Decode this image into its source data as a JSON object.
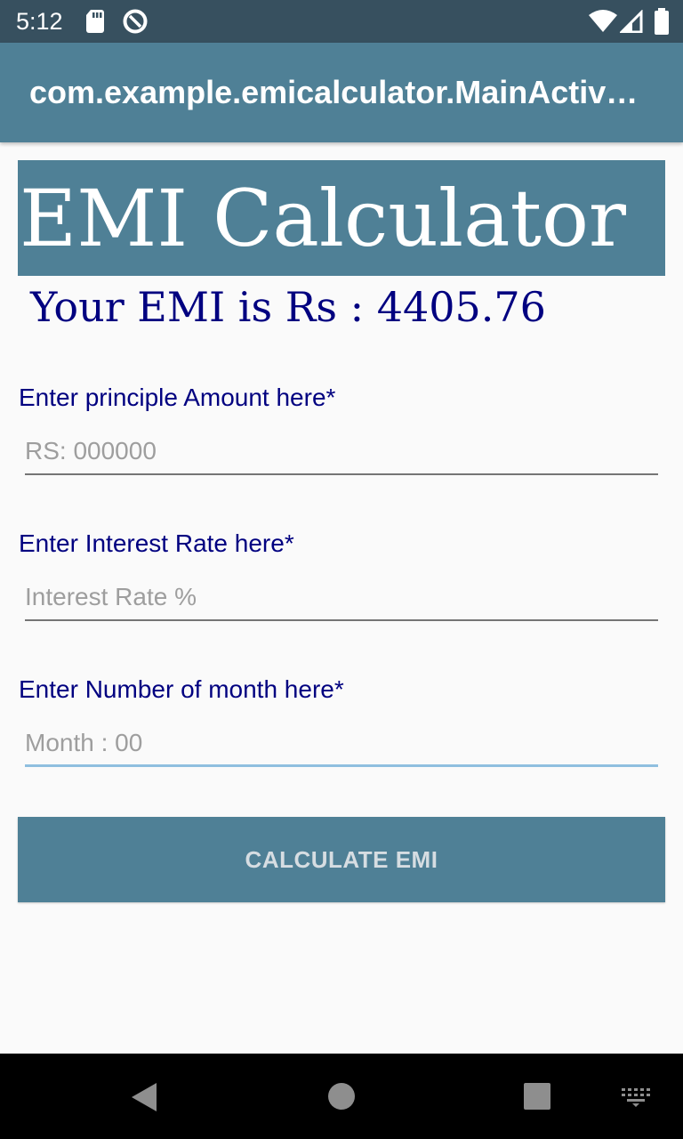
{
  "status_bar": {
    "time": "5:12",
    "icons_left": [
      "sd-card-icon",
      "data-saver-icon"
    ],
    "icons_right": [
      "wifi-icon",
      "signal-icon",
      "battery-icon"
    ]
  },
  "app_bar": {
    "title": "com.example.emicalculator.MainActivity"
  },
  "header": {
    "title": "EMI Calculator"
  },
  "result": {
    "text": "Your EMI is Rs : 4405.76"
  },
  "form": {
    "principal": {
      "label": "Enter principle Amount here*",
      "placeholder": "RS: 000000",
      "value": ""
    },
    "interest": {
      "label": "Enter Interest Rate here*",
      "placeholder": "Interest Rate %",
      "value": ""
    },
    "months": {
      "label": "Enter Number of month here*",
      "placeholder": "Month : 00",
      "value": ""
    }
  },
  "button": {
    "label": "CALCULATE EMI"
  },
  "nav_bar": {
    "buttons": [
      "back-icon",
      "home-icon",
      "recents-icon",
      "keyboard-icon"
    ]
  },
  "colors": {
    "primary": "#4f8096",
    "status_bar": "#37505f",
    "text_navy": "#000080",
    "focus_underline": "#8fbfdf",
    "background": "#fafafa"
  }
}
